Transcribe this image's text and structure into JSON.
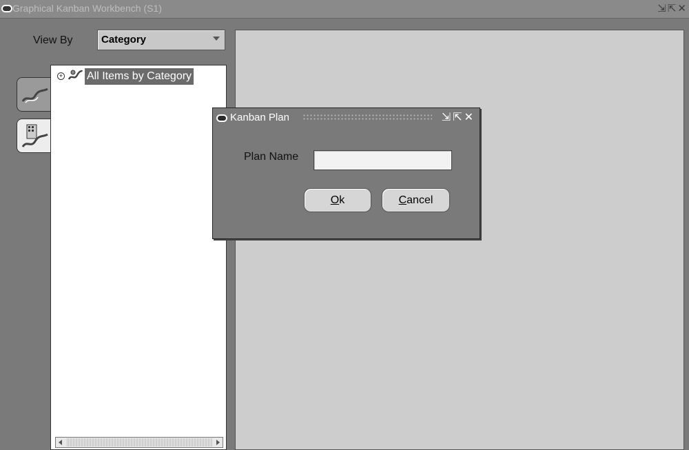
{
  "window": {
    "title": "Graphical Kanban Workbench (S1)",
    "controls": [
      "minimize-icon",
      "maximize-icon",
      "close-icon"
    ]
  },
  "view_by": {
    "label": "View By",
    "selected": "Category"
  },
  "side_tabs": [
    {
      "icon": "items-icon",
      "active": false
    },
    {
      "icon": "items-plan-icon",
      "active": true
    }
  ],
  "tree": {
    "root_label": "All Items by Category",
    "expander": "+"
  },
  "dialog": {
    "title": "Kanban Plan",
    "field_label": "Plan Name",
    "field_value": "",
    "ok_label": "Ok",
    "ok_mnemonic": "O",
    "ok_rest": "k",
    "cancel_mnemonic": "C",
    "cancel_rest": "ancel"
  },
  "colors": {
    "background": "#7a7a7a",
    "content": "#cdcdcd",
    "selection": "#6b6b6b"
  }
}
